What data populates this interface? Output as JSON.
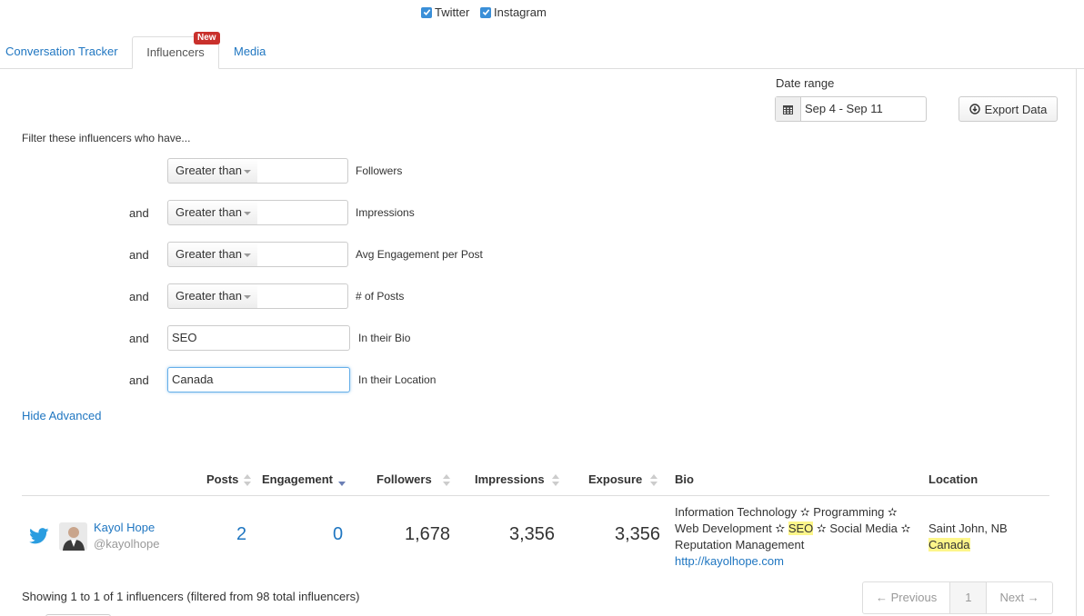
{
  "filters_top": {
    "twitter_label": "Twitter",
    "instagram_label": "Instagram"
  },
  "tabs": [
    {
      "label": "Conversation Tracker"
    },
    {
      "label": "Influencers",
      "badge": "New"
    },
    {
      "label": "Media"
    }
  ],
  "date_range": {
    "label": "Date range",
    "value": "Sep 4 - Sep 11"
  },
  "export_button": "Export Data",
  "filter_heading": "Filter these influencers who have...",
  "conjunction": "and",
  "filters": [
    {
      "operator": "Greater than",
      "value": "",
      "field": "Followers"
    },
    {
      "operator": "Greater than",
      "value": "",
      "field": "Impressions"
    },
    {
      "operator": "Greater than",
      "value": "",
      "field": "Avg Engagement per Post"
    },
    {
      "operator": "Greater than",
      "value": "",
      "field": "# of Posts"
    },
    {
      "value": "SEO",
      "field": "In their Bio"
    },
    {
      "value": "Canada",
      "field": "In their Location"
    }
  ],
  "hide_advanced": "Hide Advanced",
  "table": {
    "columns": [
      "Posts",
      "Engagement",
      "Followers",
      "Impressions",
      "Exposure",
      "Bio",
      "Location"
    ],
    "rows": [
      {
        "name": "Kayol Hope",
        "handle": "@kayolhope",
        "posts": "2",
        "engagement": "0",
        "followers": "1,678",
        "impressions": "3,356",
        "exposure": "3,356",
        "bio_line1": "Information Technology ✫ Programming ✫",
        "bio_line2_a": "Web Development ✫ ",
        "bio_line2_highlight": "SEO",
        "bio_line2_b": " ✫ Social Media ✫",
        "bio_line3": "Reputation Management",
        "bio_link": "http://kayolhope.com",
        "location_city": "Saint John, NB",
        "location_country": "Canada"
      }
    ]
  },
  "summary": "Showing 1 to 1 of 1 influencers (filtered from 98 total influencers)",
  "pagination": {
    "previous": "← Previous",
    "page": "1",
    "next": "Next →"
  },
  "colors": {
    "link": "#1f76c1",
    "badge": "#c9302c",
    "highlight": "#fdf68a",
    "twitter": "#2a9de0"
  }
}
